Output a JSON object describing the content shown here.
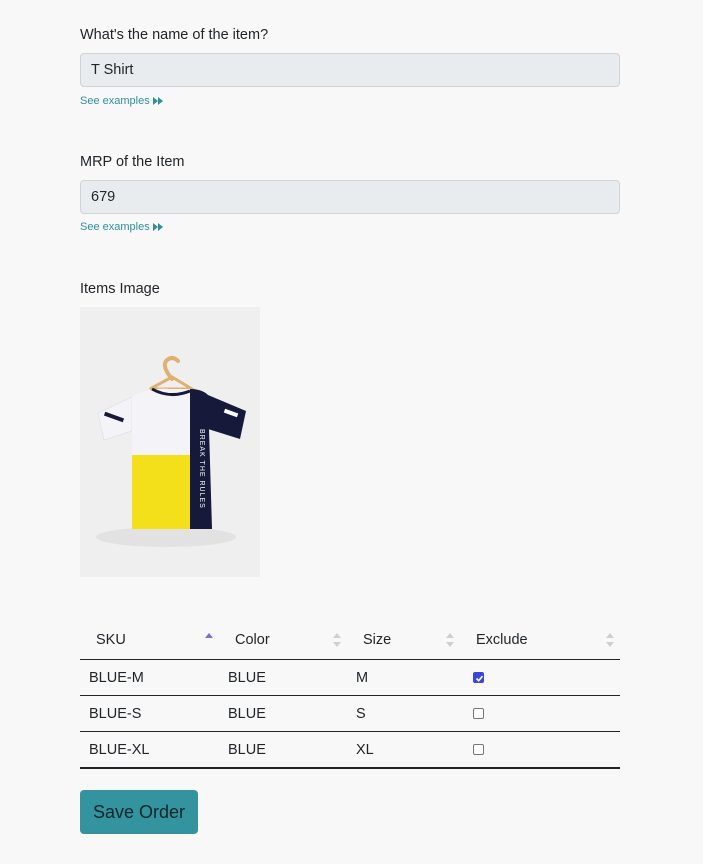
{
  "form": {
    "name_label": "What's the name of the item?",
    "name_value": "T Shirt",
    "see_examples": "See examples",
    "mrp_label": "MRP of the Item",
    "mrp_value": "679",
    "image_label": "Items Image"
  },
  "image": {
    "shirt_text": "BREAK THE RULES",
    "colors": {
      "white": "#f4f4f8",
      "yellow": "#f3e01a",
      "navy": "#16193a",
      "hanger": "#e0b070"
    }
  },
  "table": {
    "headers": [
      "SKU",
      "Color",
      "Size",
      "Exclude"
    ],
    "sorted_column": "SKU",
    "rows": [
      {
        "sku": "BLUE-M",
        "color": "BLUE",
        "size": "M",
        "exclude": true
      },
      {
        "sku": "BLUE-S",
        "color": "BLUE",
        "size": "S",
        "exclude": false
      },
      {
        "sku": "BLUE-XL",
        "color": "BLUE",
        "size": "XL",
        "exclude": false
      }
    ]
  },
  "actions": {
    "save_label": "Save Order"
  },
  "colors": {
    "accent": "#33939e",
    "link": "#2f8f9d",
    "input_bg": "#e9ecef",
    "sort_active": "#7b6fd0",
    "checkbox": "#3b46d8"
  }
}
